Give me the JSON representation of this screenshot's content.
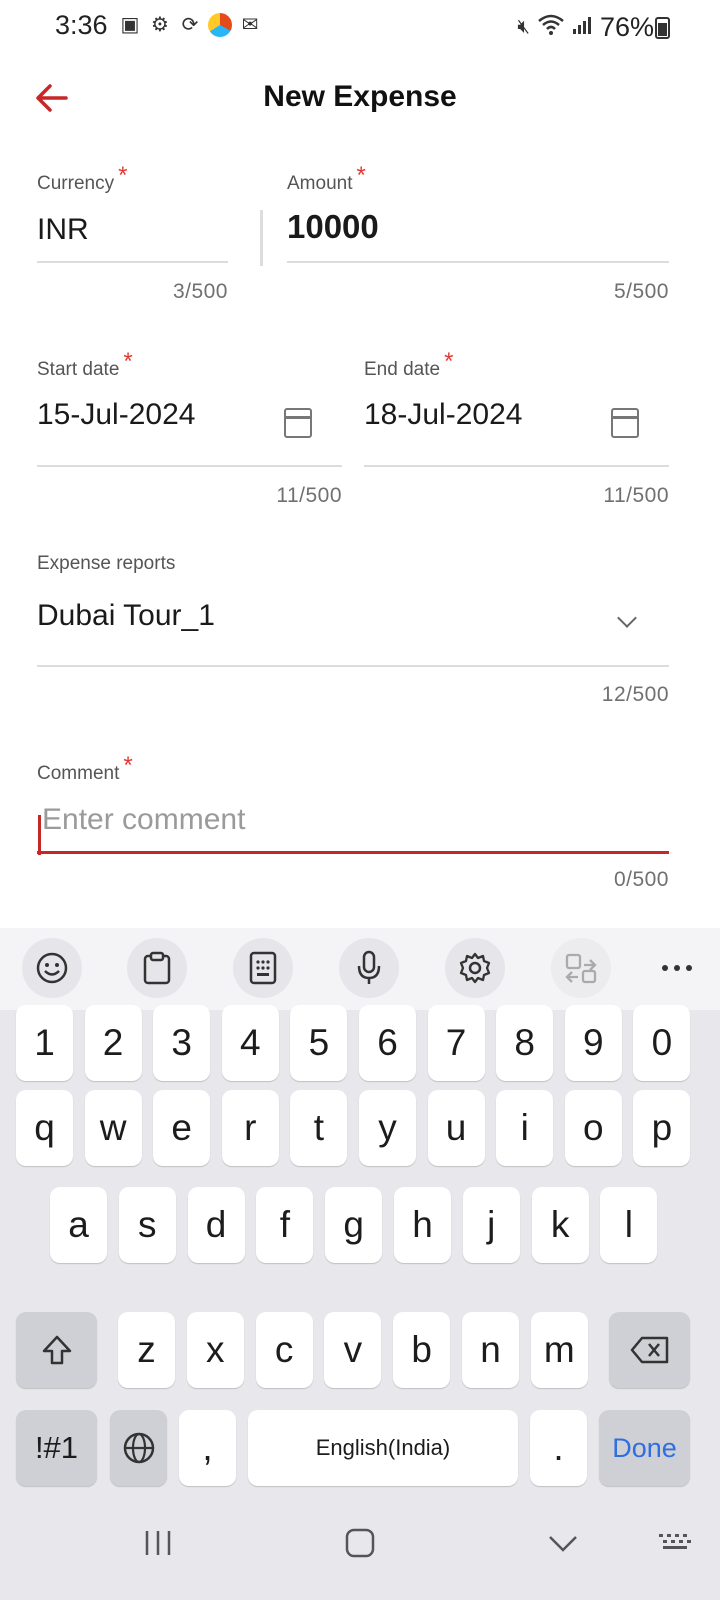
{
  "status": {
    "time": "3:36",
    "battery": "76%"
  },
  "header": {
    "title": "New Expense"
  },
  "form": {
    "currency": {
      "label": "Currency",
      "value": "INR",
      "counter": "3/500"
    },
    "amount": {
      "label": "Amount",
      "value": "10000",
      "counter": "5/500"
    },
    "start_date": {
      "label": "Start date",
      "value": "15-Jul-2024",
      "counter": "11/500"
    },
    "end_date": {
      "label": "End date",
      "value": "18-Jul-2024",
      "counter": "11/500"
    },
    "expense_reports": {
      "label": "Expense reports",
      "value": "Dubai Tour_1",
      "counter": "12/500"
    },
    "comment": {
      "label": "Comment",
      "placeholder": "Enter comment",
      "counter": "0/500"
    },
    "required_mark": "*"
  },
  "keyboard": {
    "toolbar_icons": [
      "emoji-icon",
      "clipboard-icon",
      "keypad-icon",
      "mic-icon",
      "settings-icon",
      "translate-icon",
      "more-icon"
    ],
    "row_numbers": [
      "1",
      "2",
      "3",
      "4",
      "5",
      "6",
      "7",
      "8",
      "9",
      "0"
    ],
    "row1": [
      "q",
      "w",
      "e",
      "r",
      "t",
      "y",
      "u",
      "i",
      "o",
      "p"
    ],
    "row2": [
      "a",
      "s",
      "d",
      "f",
      "g",
      "h",
      "j",
      "k",
      "l"
    ],
    "row3": [
      "z",
      "x",
      "c",
      "v",
      "b",
      "n",
      "m"
    ],
    "symbols_label": "!#1",
    "comma": ",",
    "space_label": "English(India)",
    "period": ".",
    "done_label": "Done"
  },
  "colors": {
    "accent": "#c62828",
    "required": "#e53935",
    "done": "#2e6ee0"
  }
}
